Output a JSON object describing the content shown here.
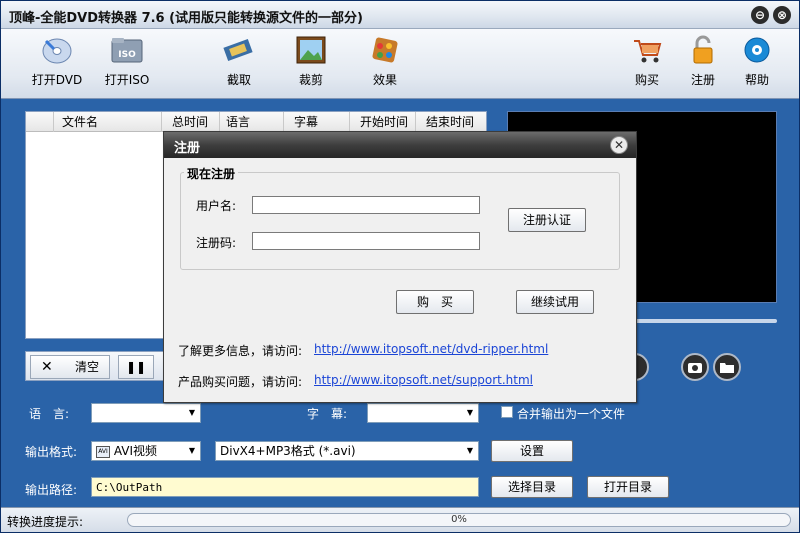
{
  "window": {
    "title": "顶峰-全能DVD转换器 7.6 (试用版只能转换源文件的一部分)",
    "minimize_glyph": "⊖",
    "close_glyph": "⊗"
  },
  "toolbar": {
    "open_dvd": "打开DVD",
    "open_iso": "打开ISO",
    "capture": "截取",
    "crop": "裁剪",
    "effects": "效果",
    "buy": "购买",
    "register": "注册",
    "help": "帮助",
    "iso_badge": "ISO"
  },
  "filelist": {
    "columns": [
      "文件名",
      "总时间",
      "语言",
      "字幕",
      "开始时间",
      "结束时间"
    ]
  },
  "controls": {
    "clear": "清空",
    "clear_glyph": "✕",
    "pause_glyph": "❚❚"
  },
  "settings": {
    "language_label": "语　言:",
    "subtitle_label": "字　幕:",
    "merge_label": "合并输出为一个文件",
    "format_label": "输出格式:",
    "format_badge": "AVI",
    "format_value": "AVI视频",
    "codec_value": "DivX4+MP3格式 (*.avi)",
    "settings_button": "设置",
    "path_label": "输出路径:",
    "path_value": "C:\\OutPath",
    "browse_button": "选择目录",
    "open_button": "打开目录"
  },
  "status": {
    "label": "转换进度提示:",
    "progress_text": "0%",
    "progress": 0
  },
  "dialog": {
    "title": "注册",
    "close_glyph": "✕",
    "group_title": "现在注册",
    "username_label": "用户名:",
    "code_label": "注册码:",
    "verify_button": "注册认证",
    "buy_button": "购　买",
    "continue_button": "继续试用",
    "more_info_label": "了解更多信息，请访问:",
    "more_info_link": "http://www.itopsoft.net/dvd-ripper.html",
    "purchase_label": "产品购买问题，请访问:",
    "purchase_link": "http://www.itopsoft.net/support.html"
  }
}
